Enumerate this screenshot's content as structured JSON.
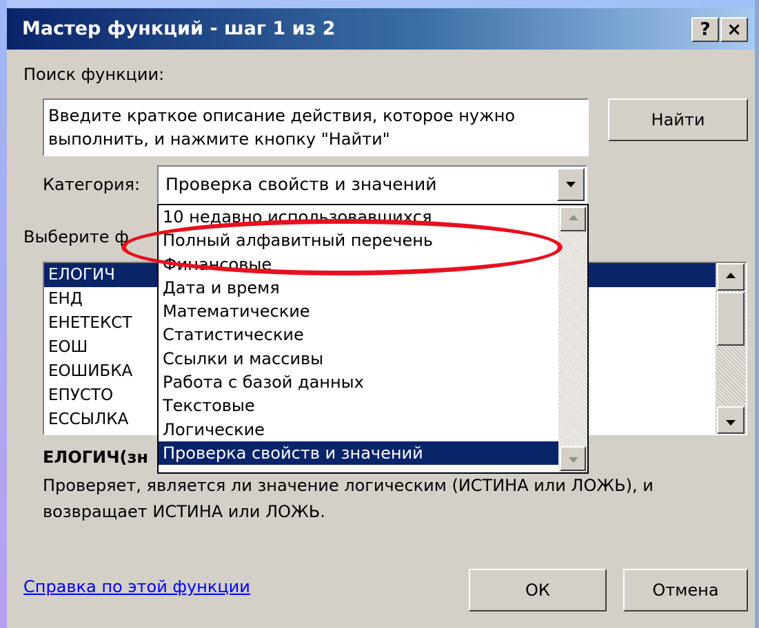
{
  "window": {
    "title": "Мастер функций - шаг 1 из 2",
    "help_btn": "?",
    "close_btn": "×"
  },
  "search": {
    "label": "Поиск функции:",
    "text": "Введите краткое описание действия, которое нужно\nвыполнить, и нажмите кнопку \"Найти\"",
    "find_button": "Найти"
  },
  "category": {
    "label": "Категория:",
    "selected": "Проверка свойств и значений",
    "options": [
      "10 недавно использовавшихся",
      "Полный алфавитный перечень",
      "Финансовые",
      "Дата и время",
      "Математические",
      "Статистические",
      "Ссылки и массивы",
      "Работа с базой данных",
      "Текстовые",
      "Логические",
      "Проверка свойств и значений"
    ]
  },
  "functions": {
    "label": "Выберите ф",
    "items": [
      "ЕЛОГИЧ",
      "ЕНД",
      "ЕНЕТЕКСТ",
      "ЕОШ",
      "ЕОШИБКА",
      "ЕПУСТО",
      "ЕССЫЛКА"
    ]
  },
  "details": {
    "signature": "ЕЛОГИЧ(зн",
    "description": "Проверяет, является ли значение логическим (ИСТИНА или ЛОЖЬ), и\nвозвращает ИСТИНА или ЛОЖЬ."
  },
  "footer": {
    "help_link": "Справка по этой функции",
    "ok": "ОК",
    "cancel": "Отмена"
  },
  "annotation": {
    "color": "#e8101e"
  }
}
